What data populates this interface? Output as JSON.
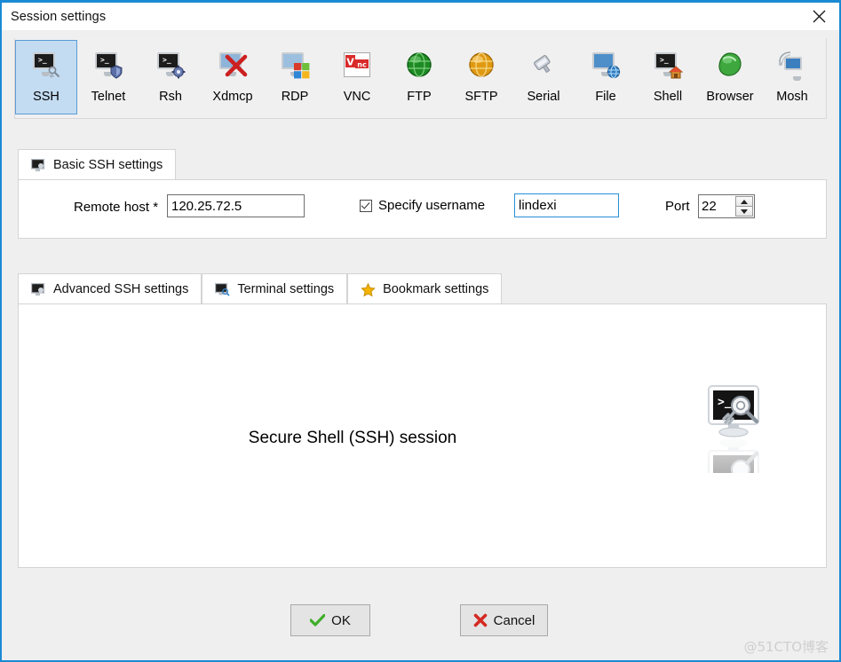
{
  "window": {
    "title": "Session settings",
    "close_icon": "close-icon",
    "accent_color": "#1a8ad4",
    "background_color": "#efefef"
  },
  "toolbar": {
    "selected": "SSH",
    "items": [
      {
        "label": "SSH",
        "icon": "terminal-key-icon",
        "selected": true
      },
      {
        "label": "Telnet",
        "icon": "terminal-shield-icon",
        "selected": false
      },
      {
        "label": "Rsh",
        "icon": "terminal-gear-icon",
        "selected": false
      },
      {
        "label": "Xdmcp",
        "icon": "monitor-red-x-icon",
        "selected": false
      },
      {
        "label": "RDP",
        "icon": "remote-desktop-icon",
        "selected": false
      },
      {
        "label": "VNC",
        "icon": "vnc-logo-icon",
        "selected": false
      },
      {
        "label": "FTP",
        "icon": "green-globe-icon",
        "selected": false
      },
      {
        "label": "SFTP",
        "icon": "orange-globe-icon",
        "selected": false
      },
      {
        "label": "Serial",
        "icon": "serial-connector-icon",
        "selected": false
      },
      {
        "label": "File",
        "icon": "monitor-globe-icon",
        "selected": false
      },
      {
        "label": "Shell",
        "icon": "terminal-house-icon",
        "selected": false
      },
      {
        "label": "Browser",
        "icon": "browser-globe-icon",
        "selected": false
      },
      {
        "label": "Mosh",
        "icon": "monitor-antenna-icon",
        "selected": false
      }
    ]
  },
  "basic": {
    "tab_label": "Basic SSH settings",
    "tab_icon": "monitor-icon",
    "remote_host_label": "Remote host *",
    "remote_host_value": "120.25.72.5",
    "specify_username_label": "Specify username",
    "specify_username_checked": true,
    "username_value": "lindexi",
    "port_label": "Port",
    "port_value": "22",
    "spin_up_icon": "chevron-up-icon",
    "spin_down_icon": "chevron-down-icon"
  },
  "lower_tabs": [
    {
      "label": "Advanced SSH settings",
      "icon": "monitor-icon"
    },
    {
      "label": "Terminal settings",
      "icon": "monitor-search-icon"
    },
    {
      "label": "Bookmark settings",
      "icon": "star-icon"
    }
  ],
  "content": {
    "session_caption": "Secure Shell (SSH) session",
    "big_icon": "ssh-terminal-key-icon"
  },
  "footer": {
    "ok_label": "OK",
    "ok_icon": "green-check-icon",
    "cancel_label": "Cancel",
    "cancel_icon": "red-x-icon"
  },
  "watermark": "@51CTO博客"
}
